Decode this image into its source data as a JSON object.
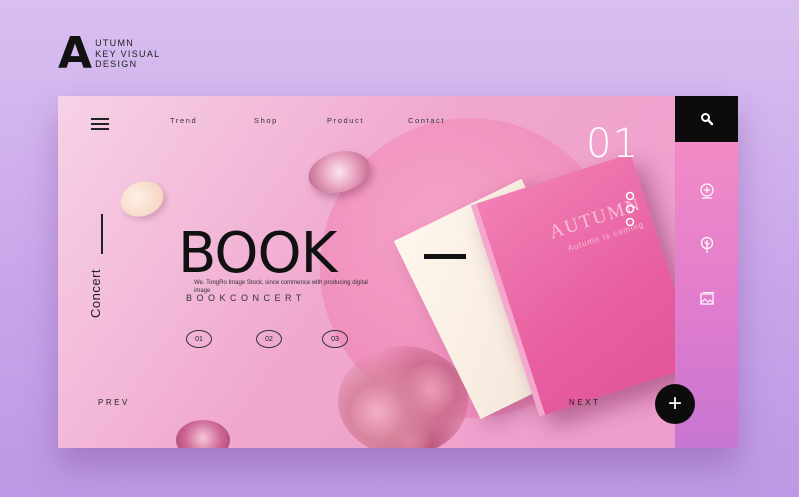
{
  "brand": {
    "letter": "A",
    "line1": "UTUMN",
    "line2": "KEY VISUAL",
    "line3": "DESIGN"
  },
  "nav": {
    "items": [
      "Trend",
      "Shop",
      "Product",
      "Contact"
    ]
  },
  "hero": {
    "slide_number": "01",
    "vertical_label": "Concert",
    "title": "BOOK",
    "description": "We. TongRo Image Stock, since commence with producing digital image",
    "subtitle": "BOOKCONCERT",
    "pager": [
      "01",
      "02",
      "03"
    ],
    "prev_label": "PREV",
    "next_label": "NEXT",
    "plus_label": "+"
  },
  "book": {
    "cover_title": "AUTUMN",
    "cover_subtitle": "Autumn is coming"
  },
  "icons": {
    "menu": "hamburger-icon",
    "search": "search-icon",
    "side": [
      "add-circle-icon",
      "tree-icon",
      "image-icon"
    ]
  },
  "colors": {
    "background": "#cfaeee",
    "card_pink": "#f0a7cf",
    "accent_black": "#0c0c0c",
    "side_strip": "#e07ccd"
  }
}
